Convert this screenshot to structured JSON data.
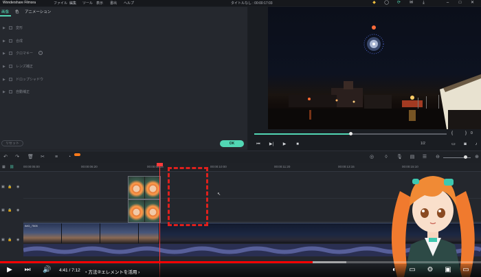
{
  "menubar": {
    "app_title": "Wondershare Filmora",
    "items": [
      "ファイル",
      "編集",
      "ツール",
      "表示",
      "書出",
      "ヘルプ"
    ],
    "doc_title": "タイトルなし : 00:00:17:03"
  },
  "inspector": {
    "tabs": [
      "画像",
      "色",
      "アニメーション"
    ],
    "properties": [
      {
        "label": "変形"
      },
      {
        "label": "合成"
      },
      {
        "label": "クロマキー"
      },
      {
        "label": "レンズ補正"
      },
      {
        "label": "ドロップシャドウ"
      },
      {
        "label": "自動補正"
      }
    ],
    "reset_label": "リセット",
    "ok_label": "OK"
  },
  "preview": {
    "progress": 0.5,
    "zoom": "1/2"
  },
  "timeline": {
    "ruler": [
      "00:00:05:00",
      "00:00:06:20",
      "00:00:08:15",
      "00:00:10:00",
      "00:00:11:20",
      "00:00:13:15",
      "00:00:15:10"
    ],
    "main_clip_label": "IMG_7505"
  },
  "youtube": {
    "time": "4:41 / 7:12",
    "chapter": "・方法②エレメントを活用 ›",
    "played": 0.65,
    "buffered": 0.72
  },
  "colors": {
    "accent": "#52d7b4",
    "playhead": "#ff3b3b",
    "highlight_box": "#e0201c",
    "yt_red": "#ff0000"
  }
}
